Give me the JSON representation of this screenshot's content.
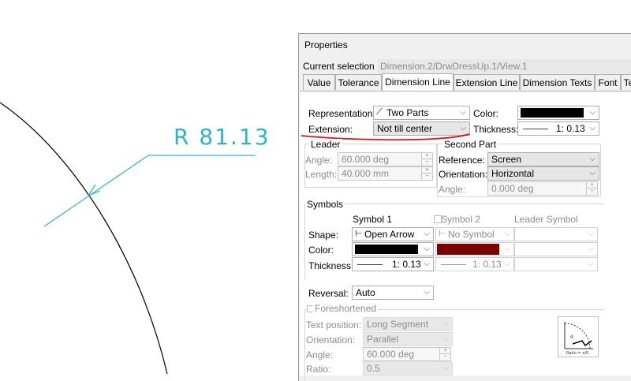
{
  "drawing": {
    "dimension_text": "R 81.13"
  },
  "colors": {
    "dimension": "#2ab5c8",
    "annotation": "#e01010",
    "symbol1_color": "#000000",
    "symbol2_color": "#7b0000",
    "main_color": "#000000"
  },
  "panel": {
    "title": "Properties",
    "current_selection_label": "Current selection :",
    "current_selection_value": "Dimension.2/DrwDressUp.1/View.1",
    "tabs": [
      "Value",
      "Tolerance",
      "Dimension Line",
      "Extension Line",
      "Dimension Texts",
      "Font",
      "Te"
    ],
    "active_tab": "Dimension Line",
    "representation_label": "Representation:",
    "representation_value": "Two Parts",
    "representation_icon": "two-parts-icon",
    "color_label": "Color:",
    "extension_label": "Extension:",
    "extension_value": "Not till center",
    "thickness_label": "Thickness:",
    "thickness_value": "1: 0.13",
    "leader": {
      "title": "Leader",
      "angle_label": "Angle:",
      "angle_value": "60.000 deg",
      "length_label": "Length:",
      "length_value": "40.000 mm"
    },
    "second_part": {
      "title": "Second Part",
      "reference_label": "Reference:",
      "reference_value": "Screen",
      "orientation_label": "Orientation:",
      "orientation_value": "Horizontal",
      "angle_label": "Angle:",
      "angle_value": "0.000 deg"
    },
    "symbols": {
      "title": "Symbols",
      "col_symbol1": "Symbol 1",
      "col_symbol2": "Symbol 2",
      "col_leader": "Leader Symbol",
      "shape_label": "Shape:",
      "shape1_value": "Open Arrow",
      "shape2_value": "No Symbol",
      "color_label": "Color:",
      "thickness_label": "Thickness:",
      "thickness1_value": "1: 0.13",
      "thickness2_value": "1: 0.13"
    },
    "reversal_label": "Reversal:",
    "reversal_value": "Auto",
    "foreshortened": {
      "title": "Foreshortened",
      "text_position_label": "Text position:",
      "text_position_value": "Long Segment",
      "orientation_label": "Orientation:",
      "orientation_value": "Parallel",
      "angle_label": "Angle:",
      "angle_value": "60.000 deg",
      "ratio_label": "Ratio:",
      "ratio_value": "0.5",
      "preview_caption": "Ratio = x/0"
    }
  }
}
